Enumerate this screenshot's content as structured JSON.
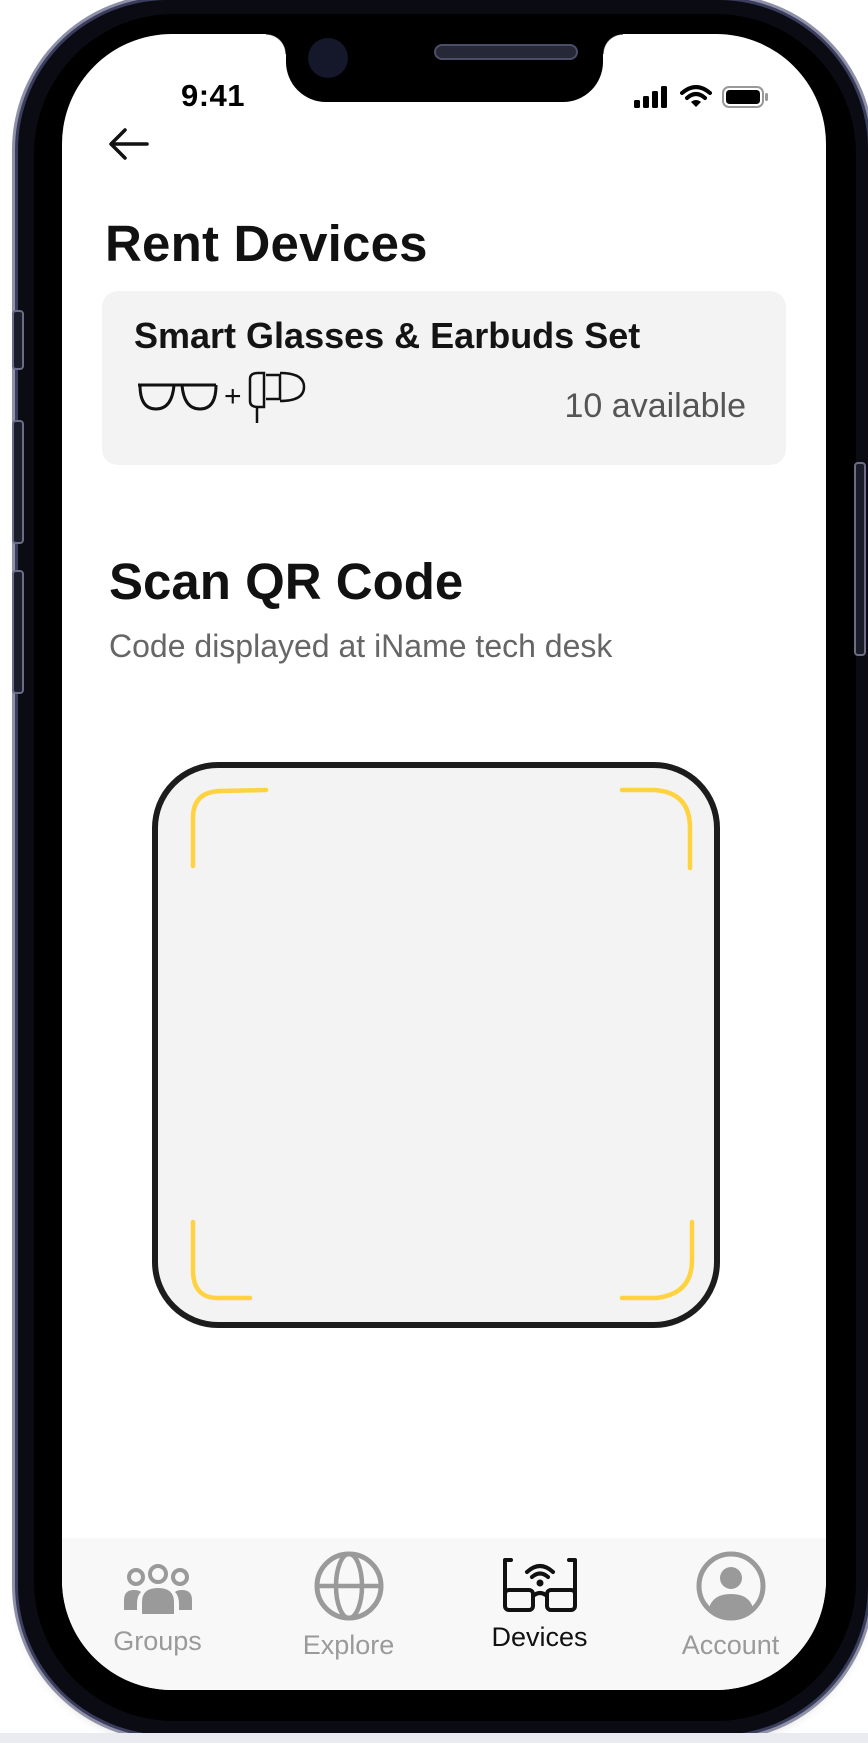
{
  "status_bar": {
    "time": "9:41"
  },
  "header": {
    "back_icon": "arrow-left-icon",
    "title": "Rent Devices"
  },
  "device_card": {
    "name": "Smart Glasses & Earbuds Set",
    "icons": [
      "glasses-icon",
      "earbuds-icon"
    ],
    "plus": "+",
    "availability": "10 available"
  },
  "scan": {
    "title": "Scan QR Code",
    "subtitle": "Code displayed at iName tech desk",
    "frame_corner_color": "#FFD23F"
  },
  "tabbar": {
    "active_color": "#111111",
    "inactive_color": "#9A9A9A",
    "tabs": [
      {
        "label": "Groups",
        "icon": "group-icon",
        "active": false
      },
      {
        "label": "Explore",
        "icon": "globe-icon",
        "active": false
      },
      {
        "label": "Devices",
        "icon": "smart-glasses-icon",
        "active": true
      },
      {
        "label": "Account",
        "icon": "account-icon",
        "active": false
      }
    ]
  }
}
